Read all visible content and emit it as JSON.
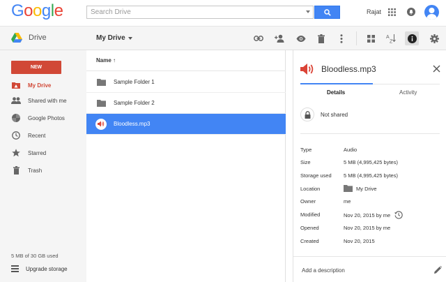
{
  "topbar": {
    "logo_letters": [
      {
        "ch": "G",
        "color": "#4285f4"
      },
      {
        "ch": "o",
        "color": "#ea4335"
      },
      {
        "ch": "o",
        "color": "#fbbc05"
      },
      {
        "ch": "g",
        "color": "#4285f4"
      },
      {
        "ch": "l",
        "color": "#34a853"
      },
      {
        "ch": "e",
        "color": "#ea4335"
      }
    ],
    "search_placeholder": "Search Drive",
    "user_name": "Rajat"
  },
  "toolbar": {
    "drive_label": "Drive",
    "location_dropdown": "My Drive",
    "icons": [
      "link-icon",
      "add-person-icon",
      "preview-icon",
      "trash-icon",
      "more-vert-icon",
      "grid-view-icon",
      "sort-az-icon",
      "info-icon",
      "settings-icon"
    ]
  },
  "sidebar": {
    "new_label": "NEW",
    "items": [
      {
        "label": "My Drive",
        "icon": "drive-icon",
        "active": true
      },
      {
        "label": "Shared with me",
        "icon": "people-icon"
      },
      {
        "label": "Google Photos",
        "icon": "photos-icon"
      },
      {
        "label": "Recent",
        "icon": "clock-icon"
      },
      {
        "label": "Starred",
        "icon": "star-icon"
      },
      {
        "label": "Trash",
        "icon": "trash-icon"
      }
    ],
    "storage_text": "5 MB of 30 GB used",
    "upgrade_label": "Upgrade storage"
  },
  "filelist": {
    "column_name": "Name ↑",
    "rows": [
      {
        "name": "Sample Folder 1",
        "type": "folder"
      },
      {
        "name": "Sample Folder 2",
        "type": "folder"
      },
      {
        "name": "Bloodless.mp3",
        "type": "audio",
        "selected": true
      }
    ]
  },
  "details": {
    "title": "Bloodless.mp3",
    "tabs": [
      "Details",
      "Activity"
    ],
    "active_tab": "Details",
    "sharing": "Not shared",
    "properties": [
      {
        "key": "Type",
        "value": "Audio"
      },
      {
        "key": "Size",
        "value": "5 MB (4,995,425 bytes)"
      },
      {
        "key": "Storage used",
        "value": "5 MB (4,995,425 bytes)"
      },
      {
        "key": "Location",
        "value": "My Drive"
      },
      {
        "key": "Owner",
        "value": "me"
      },
      {
        "key": "Modified",
        "value": "Nov 20, 2015 by me"
      },
      {
        "key": "Opened",
        "value": "Nov 20, 2015 by me"
      },
      {
        "key": "Created",
        "value": "Nov 20, 2015"
      }
    ],
    "description_placeholder": "Add a description"
  },
  "colors": {
    "accent_blue": "#4285f4",
    "new_red": "#d14836",
    "audio_red": "#db4437"
  }
}
